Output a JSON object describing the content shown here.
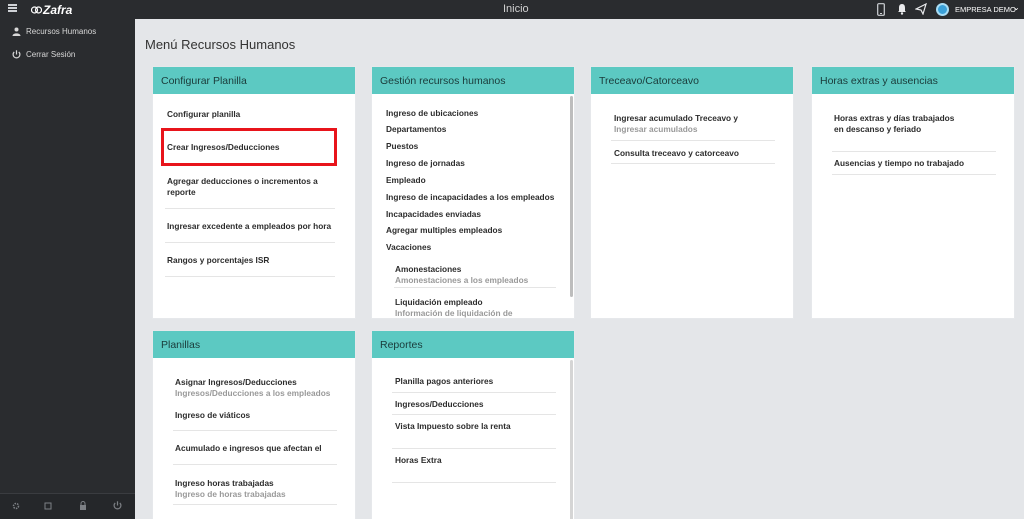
{
  "topbar": {
    "title": "Inicio",
    "company": "EMPRESA DEMO"
  },
  "sidebar": {
    "logo": "Zafra",
    "items": [
      {
        "label": "Recursos Humanos"
      },
      {
        "label": "Cerrar Sesión"
      }
    ]
  },
  "page": {
    "title": "Menú Recursos Humanos"
  },
  "cards": {
    "config": {
      "title": "Configurar Planilla",
      "items": [
        "Configurar planilla",
        "Crear Ingresos/Deducciones",
        "Agregar deducciones o incrementos a",
        "reporte",
        "Ingresar excedente a empleados por hora",
        "Rangos y porcentajes ISR"
      ]
    },
    "gestion": {
      "title": "Gestión recursos humanos",
      "items": [
        "Ingreso de ubicaciones",
        "Departamentos",
        "Puestos",
        "Ingreso de jornadas",
        "Empleado",
        "Ingreso de incapacidades a los empleados",
        "Incapacidades enviadas",
        "Agregar multiples empleados",
        "Vacaciones"
      ],
      "sub": [
        {
          "label": "Amonestaciones",
          "desc": "Amonestaciones a los empleados"
        },
        {
          "label": "Liquidación empleado",
          "desc": "Información de liquidación de"
        }
      ]
    },
    "treceavo": {
      "title": "Treceavo/Catorceavo",
      "items": [
        {
          "label": "Ingresar acumulado Treceavo y",
          "desc": "Ingresar acumulados"
        },
        {
          "label": "Consulta treceavo y catorceavo"
        }
      ]
    },
    "horas": {
      "title": "Horas extras y ausencias",
      "items": [
        {
          "label": "Horas extras y días trabajados",
          "label2": "en descanso y feriado"
        },
        {
          "label": "Ausencias y tiempo no trabajado"
        }
      ]
    },
    "planillas": {
      "title": "Planillas",
      "items": [
        {
          "label": "Asignar Ingresos/Deducciones",
          "desc": "Ingresos/Deducciones a los empleados"
        },
        {
          "label": "Ingreso de viáticos"
        },
        {
          "label": "Acumulado e ingresos que afectan el"
        },
        {
          "label": "Ingreso horas trabajadas",
          "desc": "Ingreso de horas trabajadas"
        }
      ]
    },
    "reportes": {
      "title": "Reportes",
      "items": [
        "Planilla pagos anteriores",
        "Ingresos/Deducciones",
        "Vista Impuesto sobre la renta",
        "Horas Extra"
      ]
    }
  },
  "colors": {
    "accent": "#5cc9c2",
    "highlight": "#e8141b",
    "sidebar": "#2a2c2f"
  }
}
